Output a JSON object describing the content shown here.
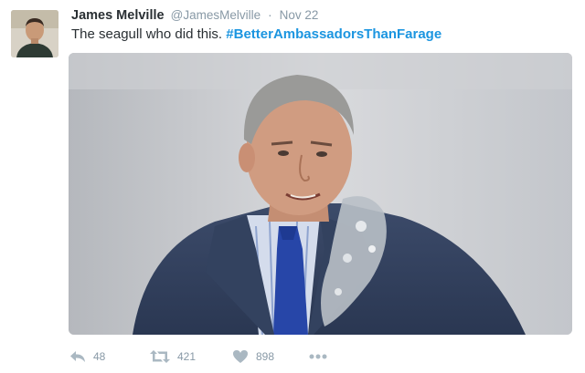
{
  "tweet": {
    "author": {
      "display_name": "James Melville",
      "handle": "@JamesMelville",
      "avatar_icon": "profile-photo"
    },
    "separator": "·",
    "date": "Nov 22",
    "text_plain": "The seagull who did this. ",
    "hashtag": "#BetterAmbassadorsThanFarage",
    "media_icon": "photo-man-in-suit-with-bird-dropping",
    "actions": {
      "reply_icon": "reply-icon",
      "reply_count": "48",
      "retweet_icon": "retweet-icon",
      "retweet_count": "421",
      "like_icon": "heart-icon",
      "like_count": "898",
      "more_icon": "more-icon"
    },
    "colors": {
      "hashtag": "#1b95e0",
      "muted": "#8899a6",
      "icon": "#aab8c2"
    }
  }
}
